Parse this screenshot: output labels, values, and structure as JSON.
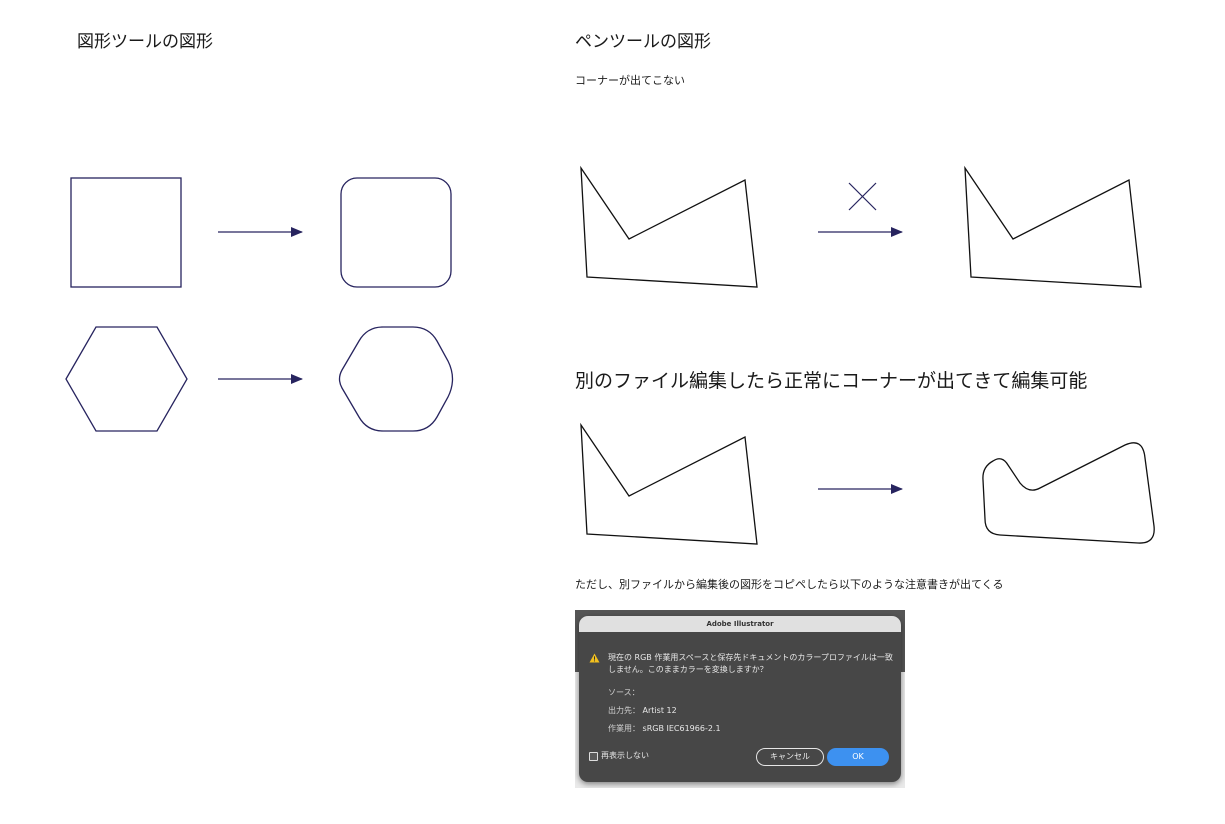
{
  "left_section": {
    "title": "図形ツールの図形"
  },
  "right_section": {
    "title": "ペンツールの図形",
    "subtitle": "コーナーが出てこない",
    "cross_mark": "×"
  },
  "middle_section": {
    "title": "別のファイル編集したら正常にコーナーが出てきて編集可能"
  },
  "bottom_note": {
    "text": "ただし、別ファイルから編集後の図形をコピペしたら以下のような注意書きが出てくる"
  },
  "dialog": {
    "title": "Adobe Illustrator",
    "message": "現在の RGB 作業用スペースと保存先ドキュメントのカラープロファイルは一致しません。このままカラーを変換しますか？",
    "source_label": "ソース：",
    "source_value": "",
    "destination_label": "出力先：",
    "destination_value": "Artist 12",
    "working_label": "作業用：",
    "working_value": "sRGB IEC61966-2.1",
    "checkbox_label": "再表示しない",
    "cancel_label": "キャンセル",
    "ok_label": "OK"
  },
  "colors": {
    "shape_stroke": "#27245f",
    "pen_stroke": "#111111",
    "ok_button": "#3d91f0",
    "dialog_bg": "#474747"
  }
}
